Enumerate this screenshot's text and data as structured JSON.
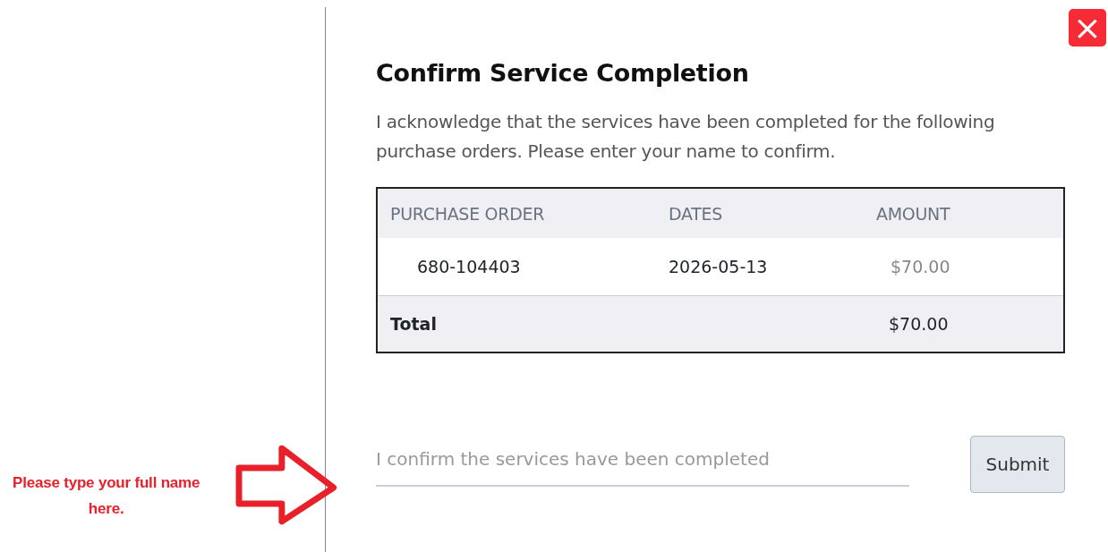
{
  "annotation": {
    "text": "Please type your full name here."
  },
  "dialog": {
    "close_label": "×",
    "title": "Confirm Service Completion",
    "description": "I acknowledge that the services have been completed for the following purchase orders. Please enter your name to confirm.",
    "table": {
      "columns": [
        "PURCHASE ORDER",
        "DATES",
        "AMOUNT"
      ],
      "rows": [
        {
          "purchase_order": "680-104403",
          "dates": "2026-05-13",
          "amount": "$70.00"
        }
      ],
      "total": {
        "label": "Total",
        "amount": "$70.00"
      }
    },
    "name_field": {
      "placeholder": "I confirm the services have been completed"
    },
    "submit_button": "Submit"
  }
}
